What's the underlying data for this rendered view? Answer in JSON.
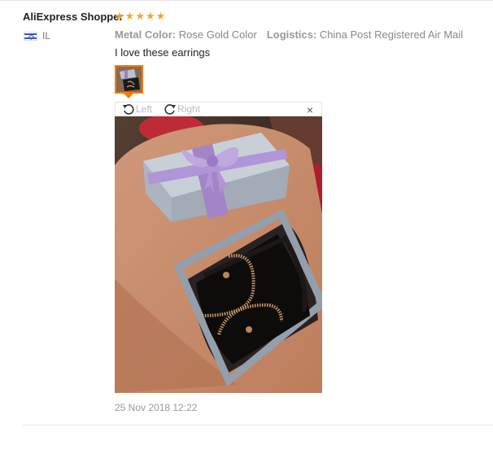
{
  "review": {
    "reviewer": "AliExpress Shopper",
    "rating": 5,
    "country_code": "IL",
    "attributes": [
      {
        "key": "Metal Color:",
        "value": "Rose Gold Color"
      },
      {
        "key": "Logistics:",
        "value": "China Post Registered Air Mail"
      }
    ],
    "text": "I love these earrings",
    "date": "25 Nov 2018 12:22"
  },
  "viewer": {
    "rotate_left_label": "Left",
    "rotate_right_label": "Right",
    "close_label": "×"
  },
  "colors": {
    "star": "#f5a623",
    "thumb_border": "#ff7a00"
  },
  "icons": {
    "rotate_left": "rotate-left-icon",
    "rotate_right": "rotate-right-icon",
    "close": "close-icon",
    "star": "star-icon",
    "flag": "israel-flag-icon"
  }
}
